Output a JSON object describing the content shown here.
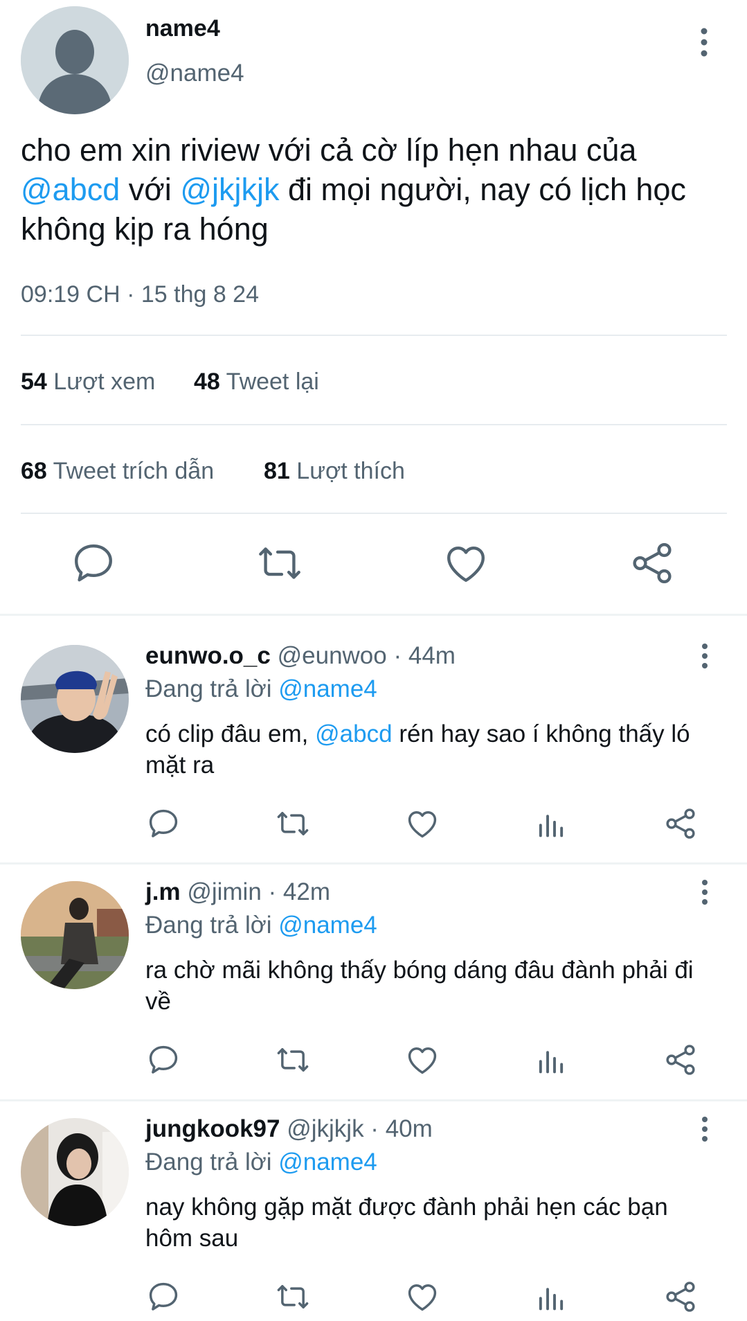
{
  "main_tweet": {
    "display_name": "name4",
    "handle": "@name4",
    "text_parts": {
      "p1": "cho em xin riview với cả cờ líp hẹn nhau của",
      "mention1": "@abcd",
      "p2": "với",
      "mention2": "@jkjkjk",
      "p3": "đi mọi người, nay có lịch học không kịp ra hóng"
    },
    "timestamp": "09:19 CH · 15 thg 8 24",
    "stats": {
      "views_count": "54",
      "views_label": "Lượt xem",
      "retweets_count": "48",
      "retweets_label": "Tweet lại",
      "quotes_count": "68",
      "quotes_label": "Tweet trích dẫn",
      "likes_count": "81",
      "likes_label": "Lượt thích"
    },
    "actions": [
      "reply-icon",
      "retweet-icon",
      "like-icon",
      "share-icon"
    ]
  },
  "replies": [
    {
      "display_name": "eunwo.o_c",
      "handle": "@eunwoo",
      "time": "44m",
      "replying_label": "Đang trả lời",
      "replying_to": "@name4",
      "text_before": "có clip đâu em,",
      "text_mention": "@abcd",
      "text_after": "rén hay sao í không thấy ló mặt ra",
      "actions": [
        "reply-icon",
        "retweet-icon",
        "like-icon",
        "analytics-icon",
        "share-icon"
      ]
    },
    {
      "display_name": "j.m",
      "handle": "@jimin",
      "time": "42m",
      "replying_label": "Đang trả lời",
      "replying_to": "@name4",
      "text_before": "ra chờ mãi không thấy bóng dáng đâu đành phải đi về",
      "actions": [
        "reply-icon",
        "retweet-icon",
        "like-icon",
        "analytics-icon",
        "share-icon"
      ]
    },
    {
      "display_name": "jungkook97",
      "handle": "@jkjkjk",
      "time": "40m",
      "replying_label": "Đang trả lời",
      "replying_to": "@name4",
      "text_before": "nay không gặp mặt được đành phải hẹn các bạn hôm sau",
      "actions": [
        "reply-icon",
        "retweet-icon",
        "like-icon",
        "analytics-icon",
        "share-icon"
      ]
    }
  ],
  "separator": " · ",
  "colors": {
    "link": "#1d9bf0",
    "muted": "#536471",
    "text": "#0f1419",
    "divider": "#eff3f4"
  }
}
